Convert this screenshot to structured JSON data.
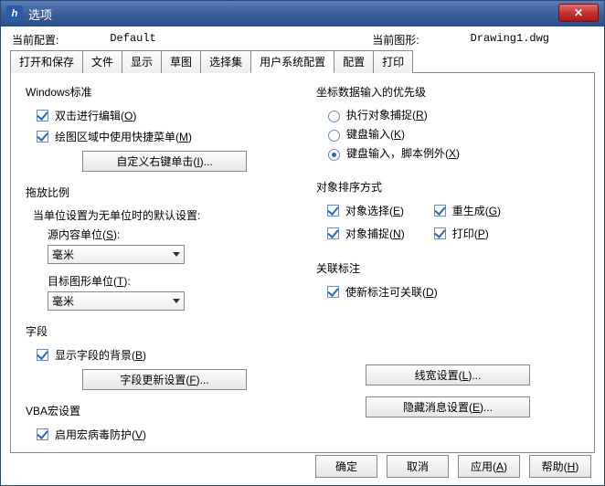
{
  "window": {
    "title": "选项"
  },
  "header": {
    "currentProfileLabel": "当前配置:",
    "currentProfileValue": "Default",
    "currentDrawingLabel": "当前图形:",
    "currentDrawingValue": "Drawing1.dwg"
  },
  "tabs": [
    "打开和保存",
    "文件",
    "显示",
    "草图",
    "选择集",
    "用户系统配置",
    "配置",
    "打印"
  ],
  "activeTab": 5,
  "left": {
    "winstd": {
      "title": "Windows标准",
      "dblclick": "双击进行编辑",
      "dblclickKey": "O",
      "shortcut": "绘图区域中使用快捷菜单",
      "shortcutKey": "M",
      "customBtn": "自定义右键单击",
      "customBtnKey": "I",
      "customBtnSuffix": "..."
    },
    "scale": {
      "title": "拖放比例",
      "subtitle": "当单位设置为无单位时的默认设置:",
      "srcLabel": "源内容单位",
      "srcKey": "S",
      "srcValue": "毫米",
      "tgtLabel": "目标图形单位",
      "tgtKey": "T",
      "tgtValue": "毫米"
    },
    "field": {
      "title": "字段",
      "showbg": "显示字段的背景",
      "showbgKey": "B",
      "updateBtn": "字段更新设置",
      "updateBtnKey": "F",
      "updateBtnSuffix": "..."
    },
    "vba": {
      "title": "VBA宏设置",
      "avp": "启用宏病毒防护",
      "avpKey": "V"
    }
  },
  "right": {
    "priority": {
      "title": "坐标数据输入的优先级",
      "opt1": "执行对象捕捉",
      "opt1Key": "R",
      "opt2": "键盘输入",
      "opt2Key": "K",
      "opt3": "键盘输入，脚本例外",
      "opt3Key": "X"
    },
    "sort": {
      "title": "对象排序方式",
      "c1": "对象选择",
      "c1Key": "E",
      "c2": "重生成",
      "c2Key": "G",
      "c3": "对象捕捉",
      "c3Key": "N",
      "c4": "打印",
      "c4Key": "P"
    },
    "assoc": {
      "title": "关联标注",
      "opt": "使新标注可关联",
      "optKey": "D"
    },
    "lineweightBtn": "线宽设置",
    "lineweightKey": "L",
    "lineweightSuffix": "...",
    "hideMsgBtn": "隐藏消息设置",
    "hideMsgKey": "E",
    "hideMsgSuffix": "..."
  },
  "footer": {
    "ok": "确定",
    "cancel": "取消",
    "apply": "应用",
    "applyKey": "A",
    "help": "帮助",
    "helpKey": "H"
  }
}
